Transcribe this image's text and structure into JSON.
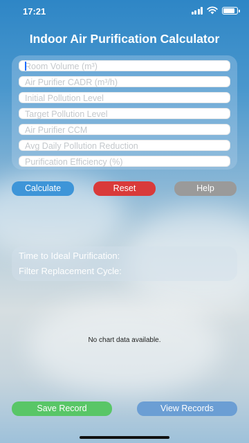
{
  "status_bar": {
    "time": "17:21"
  },
  "app": {
    "title": "Indoor Air Purification Calculator"
  },
  "form": {
    "fields": [
      {
        "placeholder": "Room Volume (m³)"
      },
      {
        "placeholder": "Air Purifier CADR (m³/h)"
      },
      {
        "placeholder": "Initial Pollution Level"
      },
      {
        "placeholder": "Target Pollution Level"
      },
      {
        "placeholder": "Air Purifier CCM"
      },
      {
        "placeholder": "Avg Daily Pollution Reduction"
      },
      {
        "placeholder": "Purification Efficiency (%)"
      }
    ]
  },
  "actions": {
    "calculate": "Calculate",
    "reset": "Reset",
    "help": "Help"
  },
  "results": {
    "time_label": "Time to Ideal Purification:",
    "filter_label": "Filter Replacement Cycle:"
  },
  "chart": {
    "empty_message": "No chart data available."
  },
  "records": {
    "save": "Save Record",
    "view": "View Records"
  },
  "colors": {
    "calculate": "#3e95d8",
    "reset": "#d93a3a",
    "help": "#9a9a9a",
    "save": "#59c667",
    "view": "#6b9ed4"
  }
}
